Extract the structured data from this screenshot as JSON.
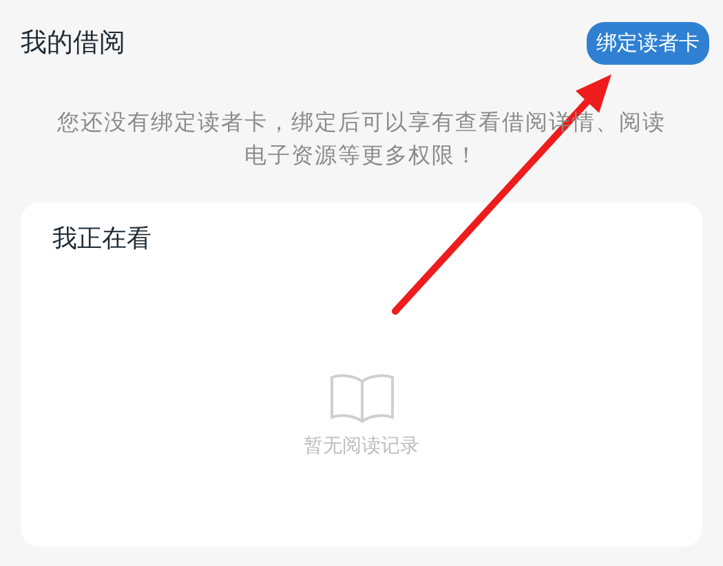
{
  "header": {
    "title": "我的借阅",
    "bind_button": "绑定读者卡"
  },
  "notice": "您还没有绑定读者卡，绑定后可以享有查看借阅详情、阅读电子资源等更多权限！",
  "reading_card": {
    "title": "我正在看",
    "empty_message": "暂无阅读记录"
  }
}
